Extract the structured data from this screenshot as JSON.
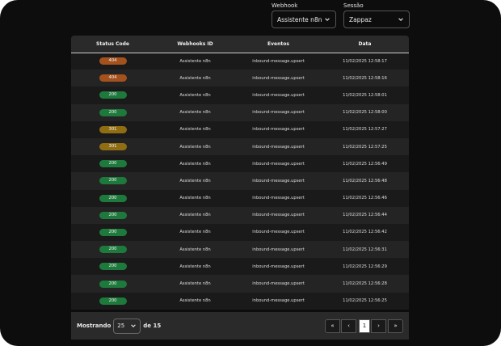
{
  "filters": {
    "webhook": {
      "label": "Webhook",
      "value": "Assistente n8n"
    },
    "sessao": {
      "label": "Sessão",
      "value": "Zappaz"
    }
  },
  "table": {
    "headers": [
      "Status Code",
      "Webhooks ID",
      "Eventos",
      "Data"
    ],
    "rows": [
      {
        "status": "404",
        "status_color": "#a4521d",
        "webhook": "Assistente n8n",
        "evento": "inbound-message.upsert",
        "data": "11/02/2025 12:58:17"
      },
      {
        "status": "404",
        "status_color": "#a4521d",
        "webhook": "Assistente n8n",
        "evento": "inbound-message.upsert",
        "data": "11/02/2025 12:58:16"
      },
      {
        "status": "200",
        "status_color": "#1e7a3c",
        "webhook": "Assistente n8n",
        "evento": "inbound-message.upsert",
        "data": "11/02/2025 12:58:01"
      },
      {
        "status": "200",
        "status_color": "#1e7a3c",
        "webhook": "Assistente n8n",
        "evento": "inbound-message.upsert",
        "data": "11/02/2025 12:58:00"
      },
      {
        "status": "301",
        "status_color": "#8f6d12",
        "webhook": "Assistente n8n",
        "evento": "inbound-message.upsert",
        "data": "11/02/2025 12:57:27"
      },
      {
        "status": "301",
        "status_color": "#8f6d12",
        "webhook": "Assistente n8n",
        "evento": "inbound-message.upsert",
        "data": "11/02/2025 12:57:25"
      },
      {
        "status": "200",
        "status_color": "#1e7a3c",
        "webhook": "Assistente n8n",
        "evento": "inbound-message.upsert",
        "data": "11/02/2025 12:56:49"
      },
      {
        "status": "200",
        "status_color": "#1e7a3c",
        "webhook": "Assistente n8n",
        "evento": "inbound-message.upsert",
        "data": "11/02/2025 12:56:48"
      },
      {
        "status": "200",
        "status_color": "#1e7a3c",
        "webhook": "Assistente n8n",
        "evento": "inbound-message.upsert",
        "data": "11/02/2025 12:56:46"
      },
      {
        "status": "200",
        "status_color": "#1e7a3c",
        "webhook": "Assistente n8n",
        "evento": "inbound-message.upsert",
        "data": "11/02/2025 12:56:44"
      },
      {
        "status": "200",
        "status_color": "#1e7a3c",
        "webhook": "Assistente n8n",
        "evento": "inbound-message.upsert",
        "data": "11/02/2025 12:56:42"
      },
      {
        "status": "200",
        "status_color": "#1e7a3c",
        "webhook": "Assistente n8n",
        "evento": "inbound-message.upsert",
        "data": "11/02/2025 12:56:31"
      },
      {
        "status": "200",
        "status_color": "#1e7a3c",
        "webhook": "Assistente n8n",
        "evento": "inbound-message.upsert",
        "data": "11/02/2025 12:56:29"
      },
      {
        "status": "200",
        "status_color": "#1e7a3c",
        "webhook": "Assistente n8n",
        "evento": "inbound-message.upsert",
        "data": "11/02/2025 12:56:28"
      },
      {
        "status": "200",
        "status_color": "#1e7a3c",
        "webhook": "Assistente n8n",
        "evento": "inbound-message.upsert",
        "data": "11/02/2025 12:56:25"
      }
    ]
  },
  "footer": {
    "showing_label": "Mostrando",
    "per_page": "25",
    "of_label": "de 15"
  },
  "pagination": {
    "first": "«",
    "prev": "‹",
    "current": "1",
    "next": "›",
    "last": "»"
  }
}
